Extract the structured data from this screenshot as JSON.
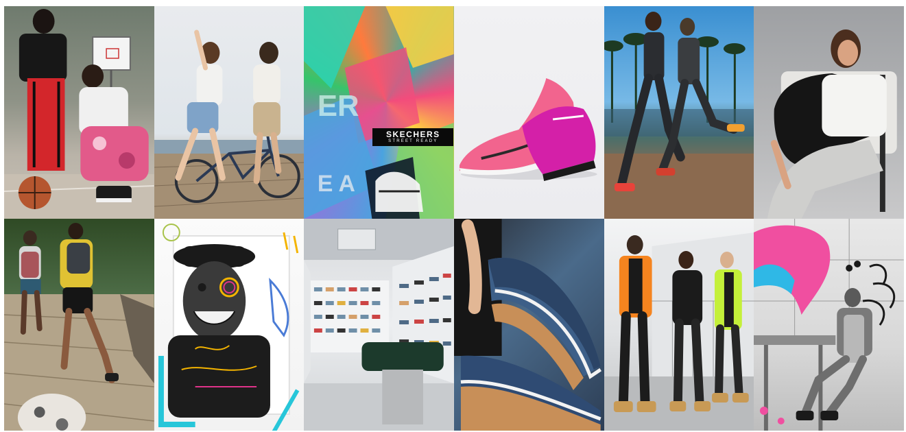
{
  "collage": {
    "tiles": [
      {
        "id": 1,
        "subject": "two people posing on basketball court with ball"
      },
      {
        "id": 2,
        "subject": "woman and man with bicycle by marina"
      },
      {
        "id": 3,
        "subject": "colorful abstract sneaker artwork"
      },
      {
        "id": 4,
        "subject": "pink athletic sneakers on white background"
      },
      {
        "id": 5,
        "subject": "two runners under palm trees"
      },
      {
        "id": 6,
        "subject": "woman in black jacket seated on chair"
      },
      {
        "id": 7,
        "subject": "two runners on wooden trail with dog"
      },
      {
        "id": 8,
        "subject": "smiling man in cap with doodle artwork"
      },
      {
        "id": 9,
        "subject": "sneaker store interior with shoe walls"
      },
      {
        "id": 10,
        "subject": "close-up of navy sneakers with gum soles"
      },
      {
        "id": 11,
        "subject": "three people in workwear and boots"
      },
      {
        "id": 12,
        "subject": "black and white artist with pink paint art"
      }
    ]
  },
  "logo": {
    "brand": "SKECHERS",
    "tagline": "STREET READY"
  }
}
